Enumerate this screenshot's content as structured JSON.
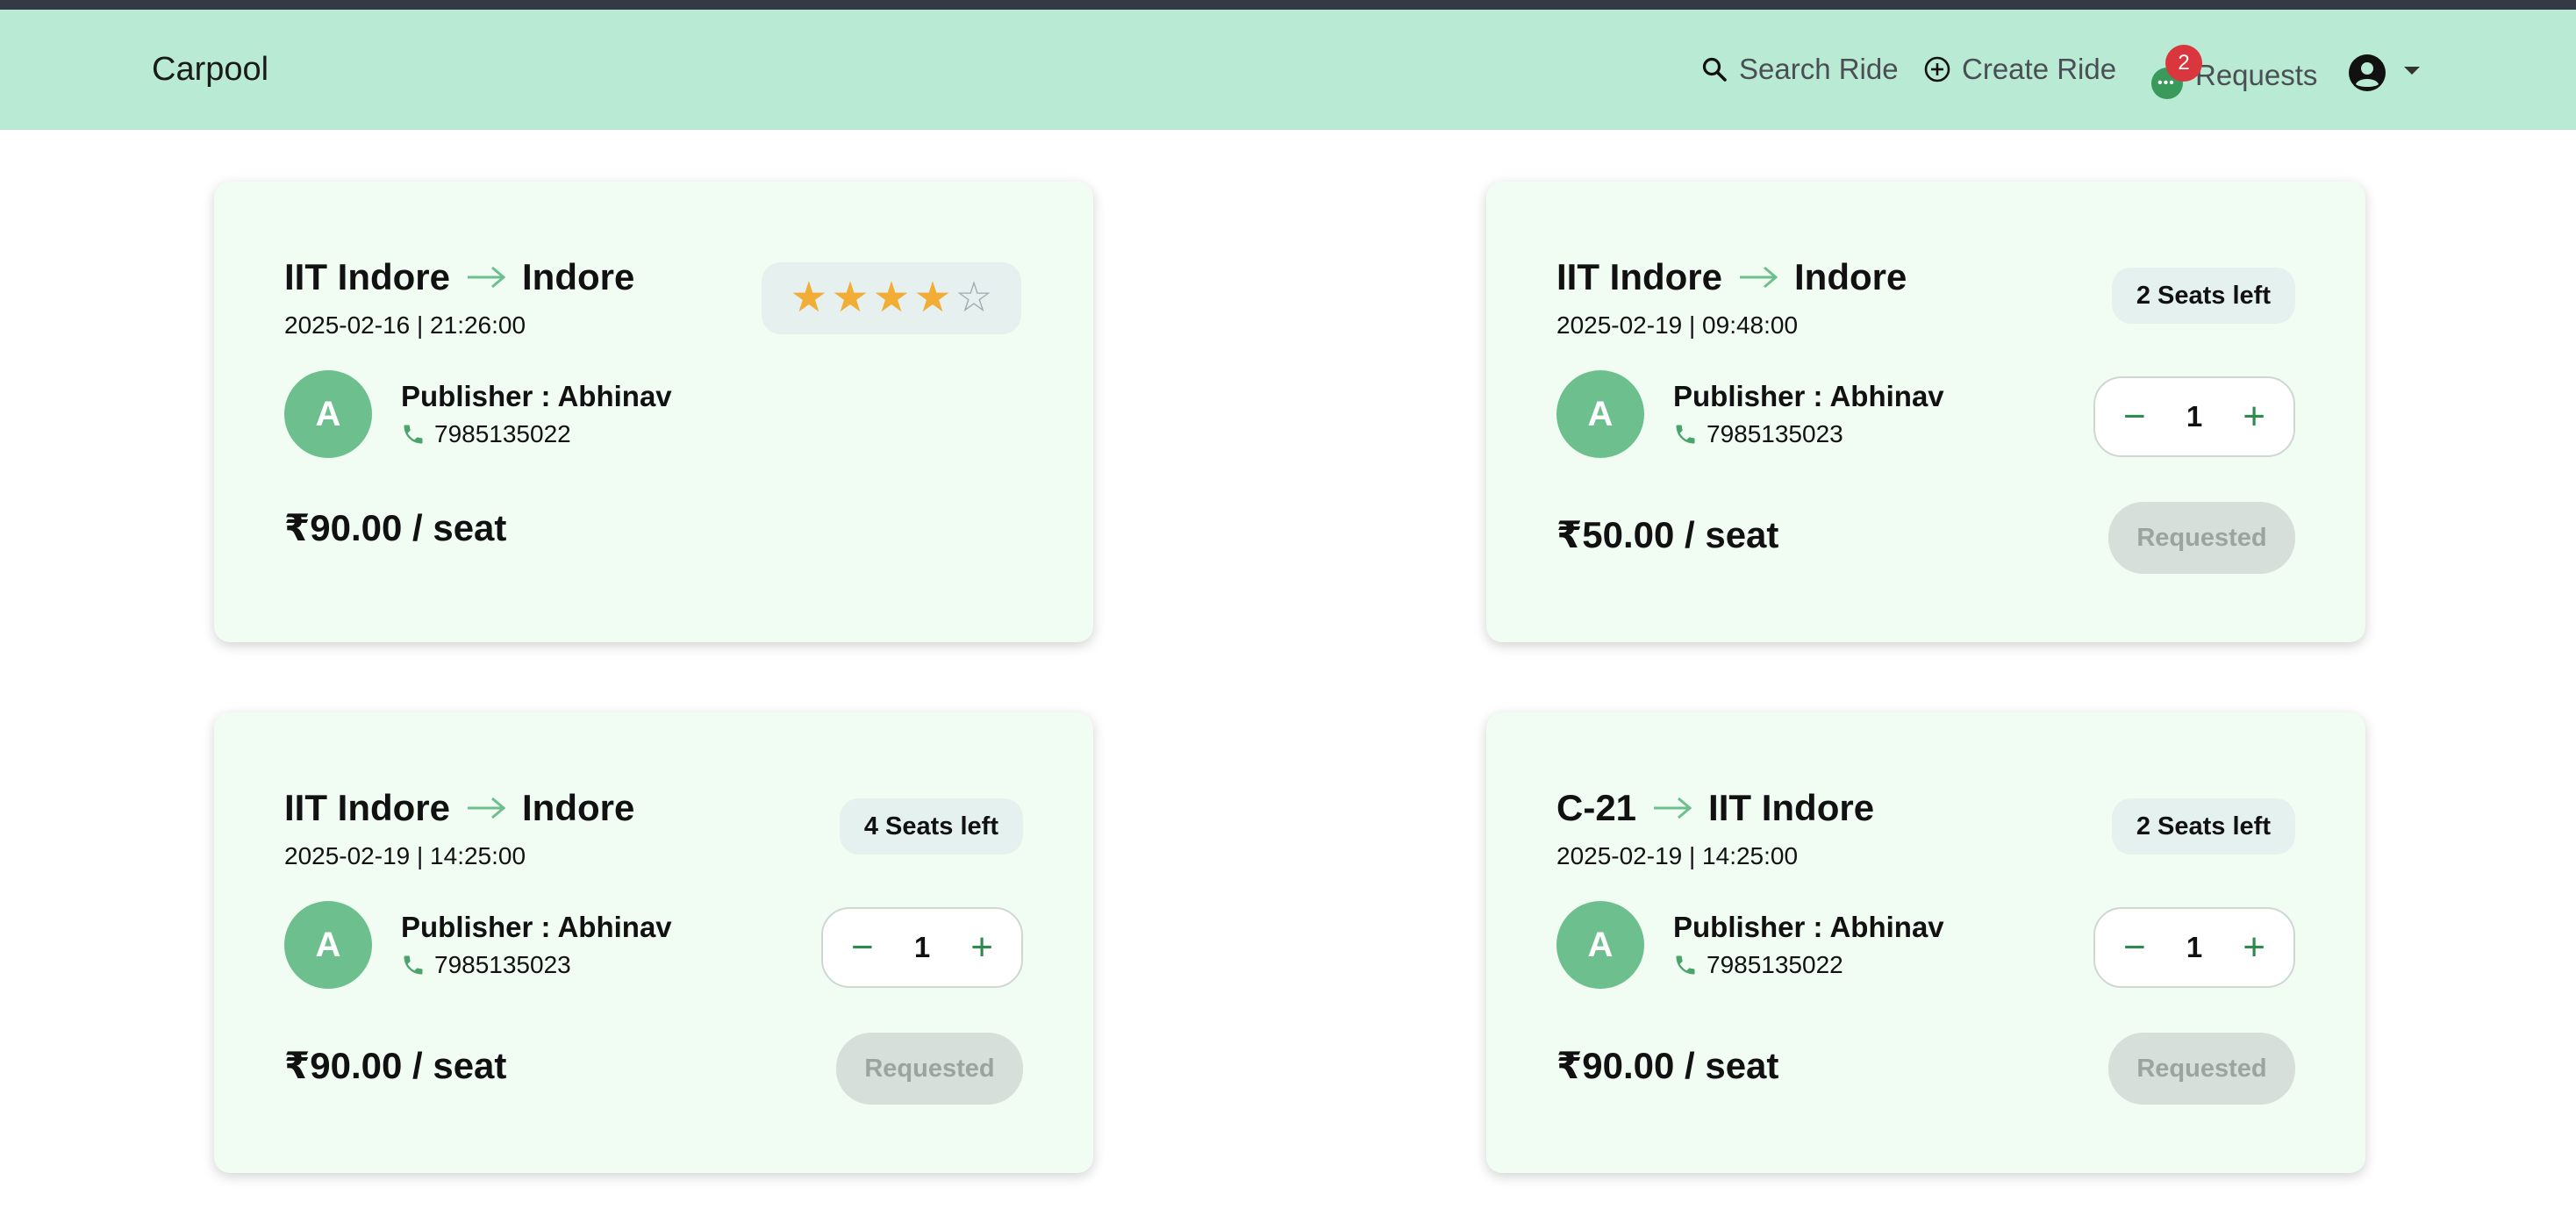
{
  "navbar": {
    "brand": "Carpool",
    "search_label": "Search Ride",
    "create_label": "Create Ride",
    "requests_label": "Requests",
    "requests_badge": "2",
    "dots": "•••"
  },
  "cards": [
    {
      "from": "IIT Indore",
      "to": "Indore",
      "datetime": "2025-02-16 | 21:26:00",
      "avatar_initial": "A",
      "publisher": "Publisher : Abhinav",
      "phone": "7985135022",
      "price": "₹90.00 / seat",
      "rating": 4,
      "rating_max": 5
    },
    {
      "from": "IIT Indore",
      "to": "Indore",
      "datetime": "2025-02-19 | 09:48:00",
      "avatar_initial": "A",
      "publisher": "Publisher : Abhinav",
      "phone": "7985135023",
      "price": "₹50.00 / seat",
      "seats_left": "2 Seats left",
      "qty": "1",
      "action": "Requested"
    },
    {
      "from": "IIT Indore",
      "to": "Indore",
      "datetime": "2025-02-19 | 14:25:00",
      "avatar_initial": "A",
      "publisher": "Publisher : Abhinav",
      "phone": "7985135023",
      "price": "₹90.00 / seat",
      "seats_left": "4 Seats left",
      "qty": "1",
      "action": "Requested"
    },
    {
      "from": "C-21",
      "to": "IIT Indore",
      "datetime": "2025-02-19 | 14:25:00",
      "avatar_initial": "A",
      "publisher": "Publisher : Abhinav",
      "phone": "7985135022",
      "price": "₹90.00 / seat",
      "seats_left": "2 Seats left",
      "qty": "1",
      "action": "Requested"
    }
  ],
  "stepper_symbols": {
    "minus": "−",
    "plus": "+"
  },
  "star_glyphs": {
    "on": "★",
    "off": "☆"
  },
  "colors": {
    "navbar_bg": "#b9ead3",
    "card_bg": "#f1fcf3",
    "avatar_bg": "#6dc08e",
    "accent_green": "#2f8a4f",
    "star_on": "#f1ad36",
    "badge_red": "#d9363e"
  }
}
